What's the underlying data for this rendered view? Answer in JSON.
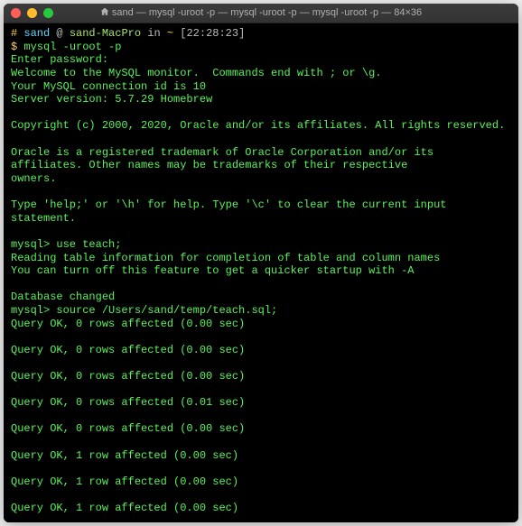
{
  "window": {
    "title": "sand — mysql -uroot -p — mysql -uroot -p — mysql -uroot -p — 84×36"
  },
  "prompt": {
    "hash": "#",
    "user": "sand",
    "at": "@",
    "host": "sand-MacPro",
    "in_word": "in",
    "path": "~",
    "time": "[22:28:23]"
  },
  "command": {
    "dollar": "$",
    "text": "mysql -uroot -p"
  },
  "output_lines": [
    "Enter password:",
    "Welcome to the MySQL monitor.  Commands end with ; or \\g.",
    "Your MySQL connection id is 10",
    "Server version: 5.7.29 Homebrew",
    "",
    "Copyright (c) 2000, 2020, Oracle and/or its affiliates. All rights reserved.",
    "",
    "Oracle is a registered trademark of Oracle Corporation and/or its",
    "affiliates. Other names may be trademarks of their respective",
    "owners.",
    "",
    "Type 'help;' or '\\h' for help. Type '\\c' to clear the current input statement.",
    "",
    "mysql> use teach;",
    "Reading table information for completion of table and column names",
    "You can turn off this feature to get a quicker startup with -A",
    "",
    "Database changed",
    "mysql> source /Users/sand/temp/teach.sql;",
    "Query OK, 0 rows affected (0.00 sec)",
    "",
    "Query OK, 0 rows affected (0.00 sec)",
    "",
    "Query OK, 0 rows affected (0.00 sec)",
    "",
    "Query OK, 0 rows affected (0.01 sec)",
    "",
    "Query OK, 0 rows affected (0.00 sec)",
    "",
    "Query OK, 1 row affected (0.00 sec)",
    "",
    "Query OK, 1 row affected (0.00 sec)",
    "",
    "Query OK, 1 row affected (0.00 sec)"
  ]
}
